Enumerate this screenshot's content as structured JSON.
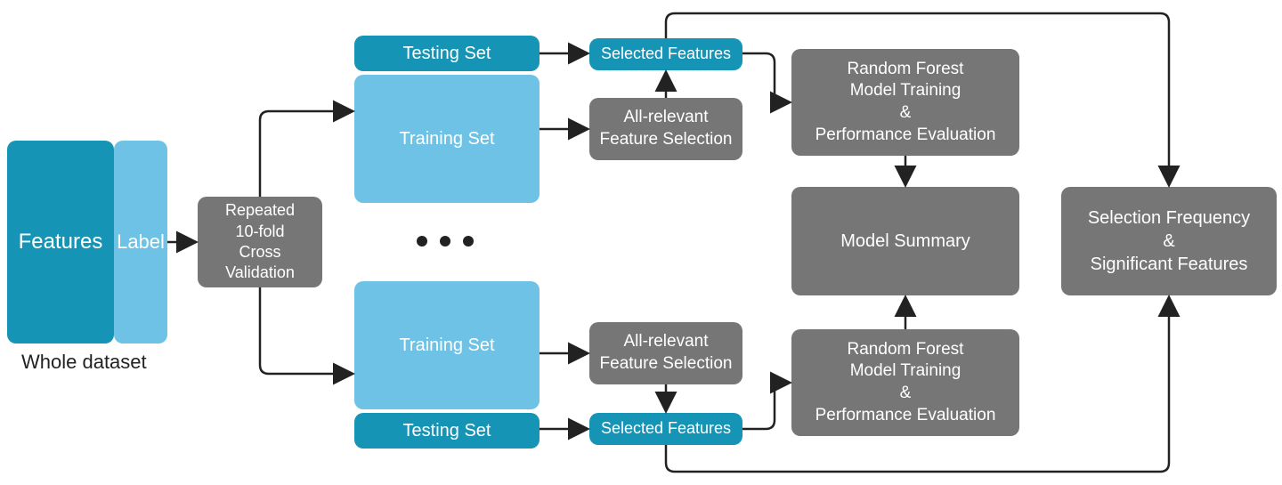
{
  "nodes": {
    "features": "Features",
    "label": "Label",
    "whole_dataset": "Whole dataset",
    "cv": "Repeated\n10-fold\nCross Validation",
    "testing_set": "Testing Set",
    "training_set": "Training Set",
    "all_relevant": "All-relevant\nFeature Selection",
    "selected_features": "Selected Features",
    "rf_eval": "Random Forest\nModel Training\n&\nPerformance Evaluation",
    "model_summary": "Model Summary",
    "selection_freq": "Selection Frequency\n&\nSignificant Features"
  }
}
